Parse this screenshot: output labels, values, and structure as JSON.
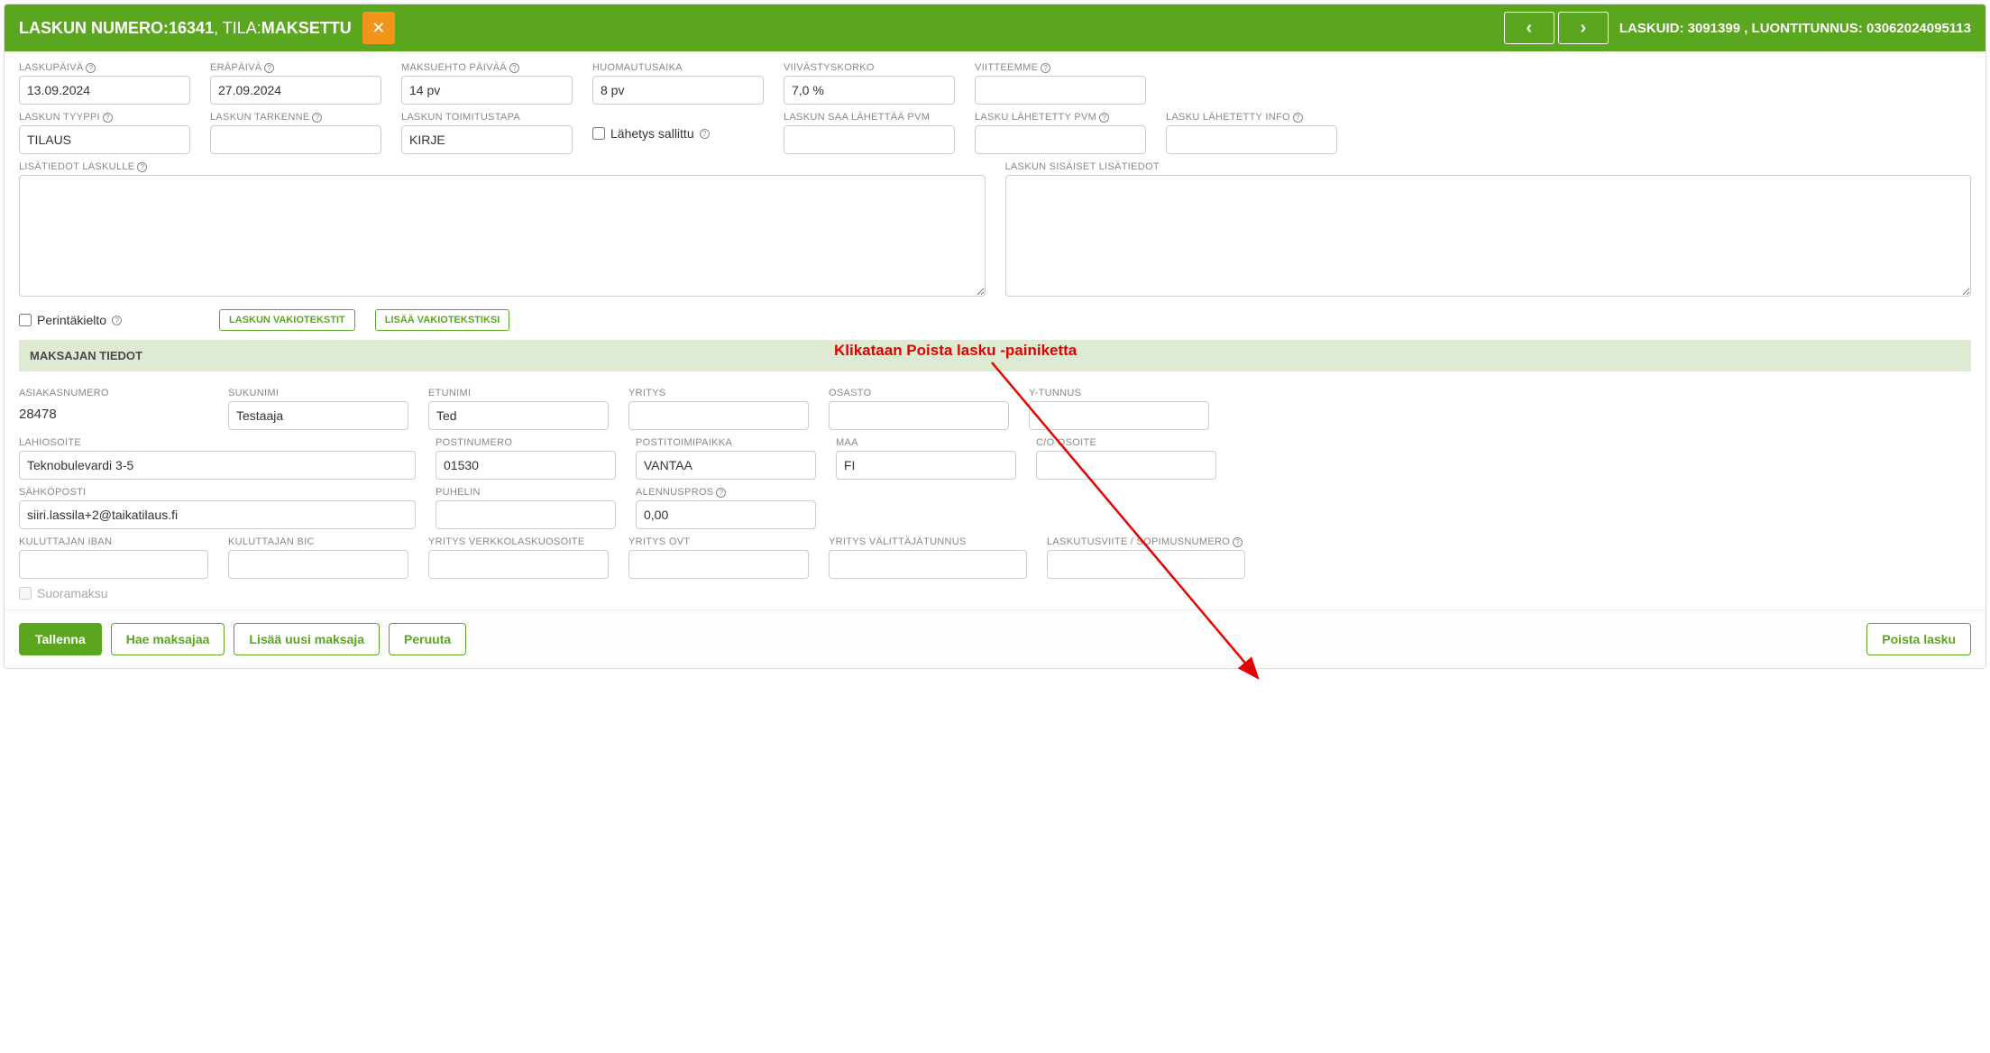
{
  "header": {
    "prefix": "LASKUN NUMERO: ",
    "number": "16341",
    "status_prefix": ", TILA: ",
    "status": "MAKSETTU",
    "right_text": "LASKUID: 3091399 , LUONTITUNNUS: 03062024095113"
  },
  "labels": {
    "laskupaiva": "LASKUPÄIVÄ",
    "erapaiva": "ERÄPÄIVÄ",
    "maksuehto": "MAKSUEHTO PÄIVÄÄ",
    "huomautusaika": "HUOMAUTUSAIKA",
    "viivastyskorko": "VIIVÄSTYSKORKO",
    "viitteemme": "VIITTEEMME",
    "laskun_tyyppi": "LASKUN TYYPPI",
    "laskun_tarkenne": "LASKUN TARKENNE",
    "toimitustapa": "LASKUN TOIMITUSTAPA",
    "lahetys_sallittu": "Lähetys sallittu",
    "saa_lahettaa": "LASKUN SAA LÄHETTÄÄ PVM",
    "lahetetty_pvm": "LASKU LÄHETETTY PVM",
    "lahetetty_info": "LASKU LÄHETETTY INFO",
    "lisatiedot": "LISÄTIEDOT LASKULLE",
    "sisaiset": "LASKUN SISÄISET LISÄTIEDOT",
    "perintakielto": "Perintäkielto",
    "btn_vakio": "LASKUN VAKIOTEKSTIT",
    "btn_lisaa_vakio": "LISÄÄ VAKIOTEKSTIKSI",
    "section_maksajan": "MAKSAJAN TIEDOT",
    "asiakasnumero": "ASIAKASNUMERO",
    "sukunimi": "SUKUNIMI",
    "etunimi": "ETUNIMI",
    "yritys": "YRITYS",
    "osasto": "OSASTO",
    "ytunnus": "Y-TUNNUS",
    "lahiosoite": "LAHIOSOITE",
    "postinumero": "POSTINUMERO",
    "postitoimipaikka": "POSTITOIMIPAIKKA",
    "maa": "MAA",
    "co_osoite": "C/O OSOITE",
    "sahkoposti": "SÄHKÖPOSTI",
    "puhelin": "PUHELIN",
    "alennuspros": "ALENNUSPROS",
    "kuluttajan_iban": "KULUTTAJAN IBAN",
    "kuluttajan_bic": "KULUTTAJAN BIC",
    "yritys_verkko": "YRITYS VERKKOLASKUOSOITE",
    "yritys_ovt": "YRITYS OVT",
    "valittaja": "YRITYS VÄLITTÄJÄTUNNUS",
    "laskutusviite": "LASKUTUSVIITE / SOPIMUSNUMERO",
    "suoramaksu": "Suoramaksu"
  },
  "values": {
    "laskupaiva": "13.09.2024",
    "erapaiva": "27.09.2024",
    "maksuehto": "14 pv",
    "huomautusaika": "8 pv",
    "viivastyskorko": "7,0 %",
    "viitteemme": "",
    "laskun_tyyppi": "TILAUS",
    "laskun_tarkenne": "",
    "toimitustapa": "KIRJE",
    "saa_lahettaa": "",
    "lahetetty_pvm": "",
    "lahetetty_info": "",
    "lisatiedot": "",
    "sisaiset": "",
    "asiakasnumero": "28478",
    "sukunimi": "Testaaja",
    "etunimi": "Ted",
    "yritys": "",
    "osasto": "",
    "ytunnus": "",
    "lahiosoite": "Teknobulevardi 3-5",
    "postinumero": "01530",
    "postitoimipaikka": "VANTAA",
    "maa": "FI",
    "co_osoite": "",
    "sahkoposti": "siiri.lassila+2@taikatilaus.fi",
    "puhelin": "",
    "alennuspros": "0,00",
    "kuluttajan_iban": "",
    "kuluttajan_bic": "",
    "yritys_verkko": "",
    "yritys_ovt": "",
    "valittaja": "",
    "laskutusviite": ""
  },
  "actions": {
    "tallenna": "Tallenna",
    "hae_maksajaa": "Hae maksajaa",
    "lisaa_uusi": "Lisää uusi maksaja",
    "peruuta": "Peruuta",
    "poista": "Poista lasku"
  },
  "annotation": "Klikataan Poista lasku -painiketta"
}
